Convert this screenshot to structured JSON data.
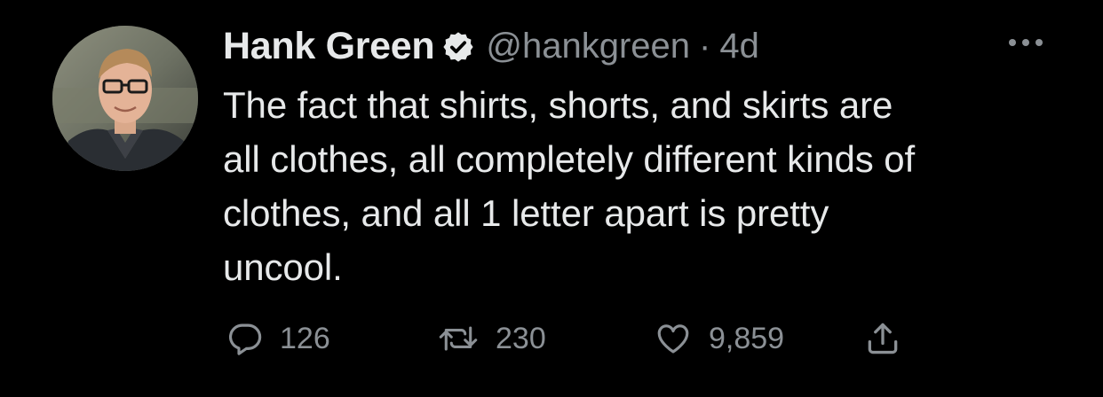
{
  "tweet": {
    "author": {
      "name": "Hank Green",
      "handle": "@hankgreen",
      "verified": true
    },
    "separator": "·",
    "timestamp": "4d",
    "text": "The fact that shirts, shorts, and skirts are\nall clothes, all completely different kinds of\nclothes, and all 1 letter apart is pretty\nuncool.",
    "stats": {
      "replies": "126",
      "retweets": "230",
      "likes": "9,859"
    }
  },
  "icons": {
    "verified": "verified-badge-icon",
    "more": "more-options-icon",
    "reply": "reply-icon",
    "retweet": "retweet-icon",
    "like": "heart-icon",
    "share": "share-icon"
  },
  "colors": {
    "background": "#000000",
    "text_primary": "#e7e9ea",
    "text_secondary": "#8b9095"
  }
}
